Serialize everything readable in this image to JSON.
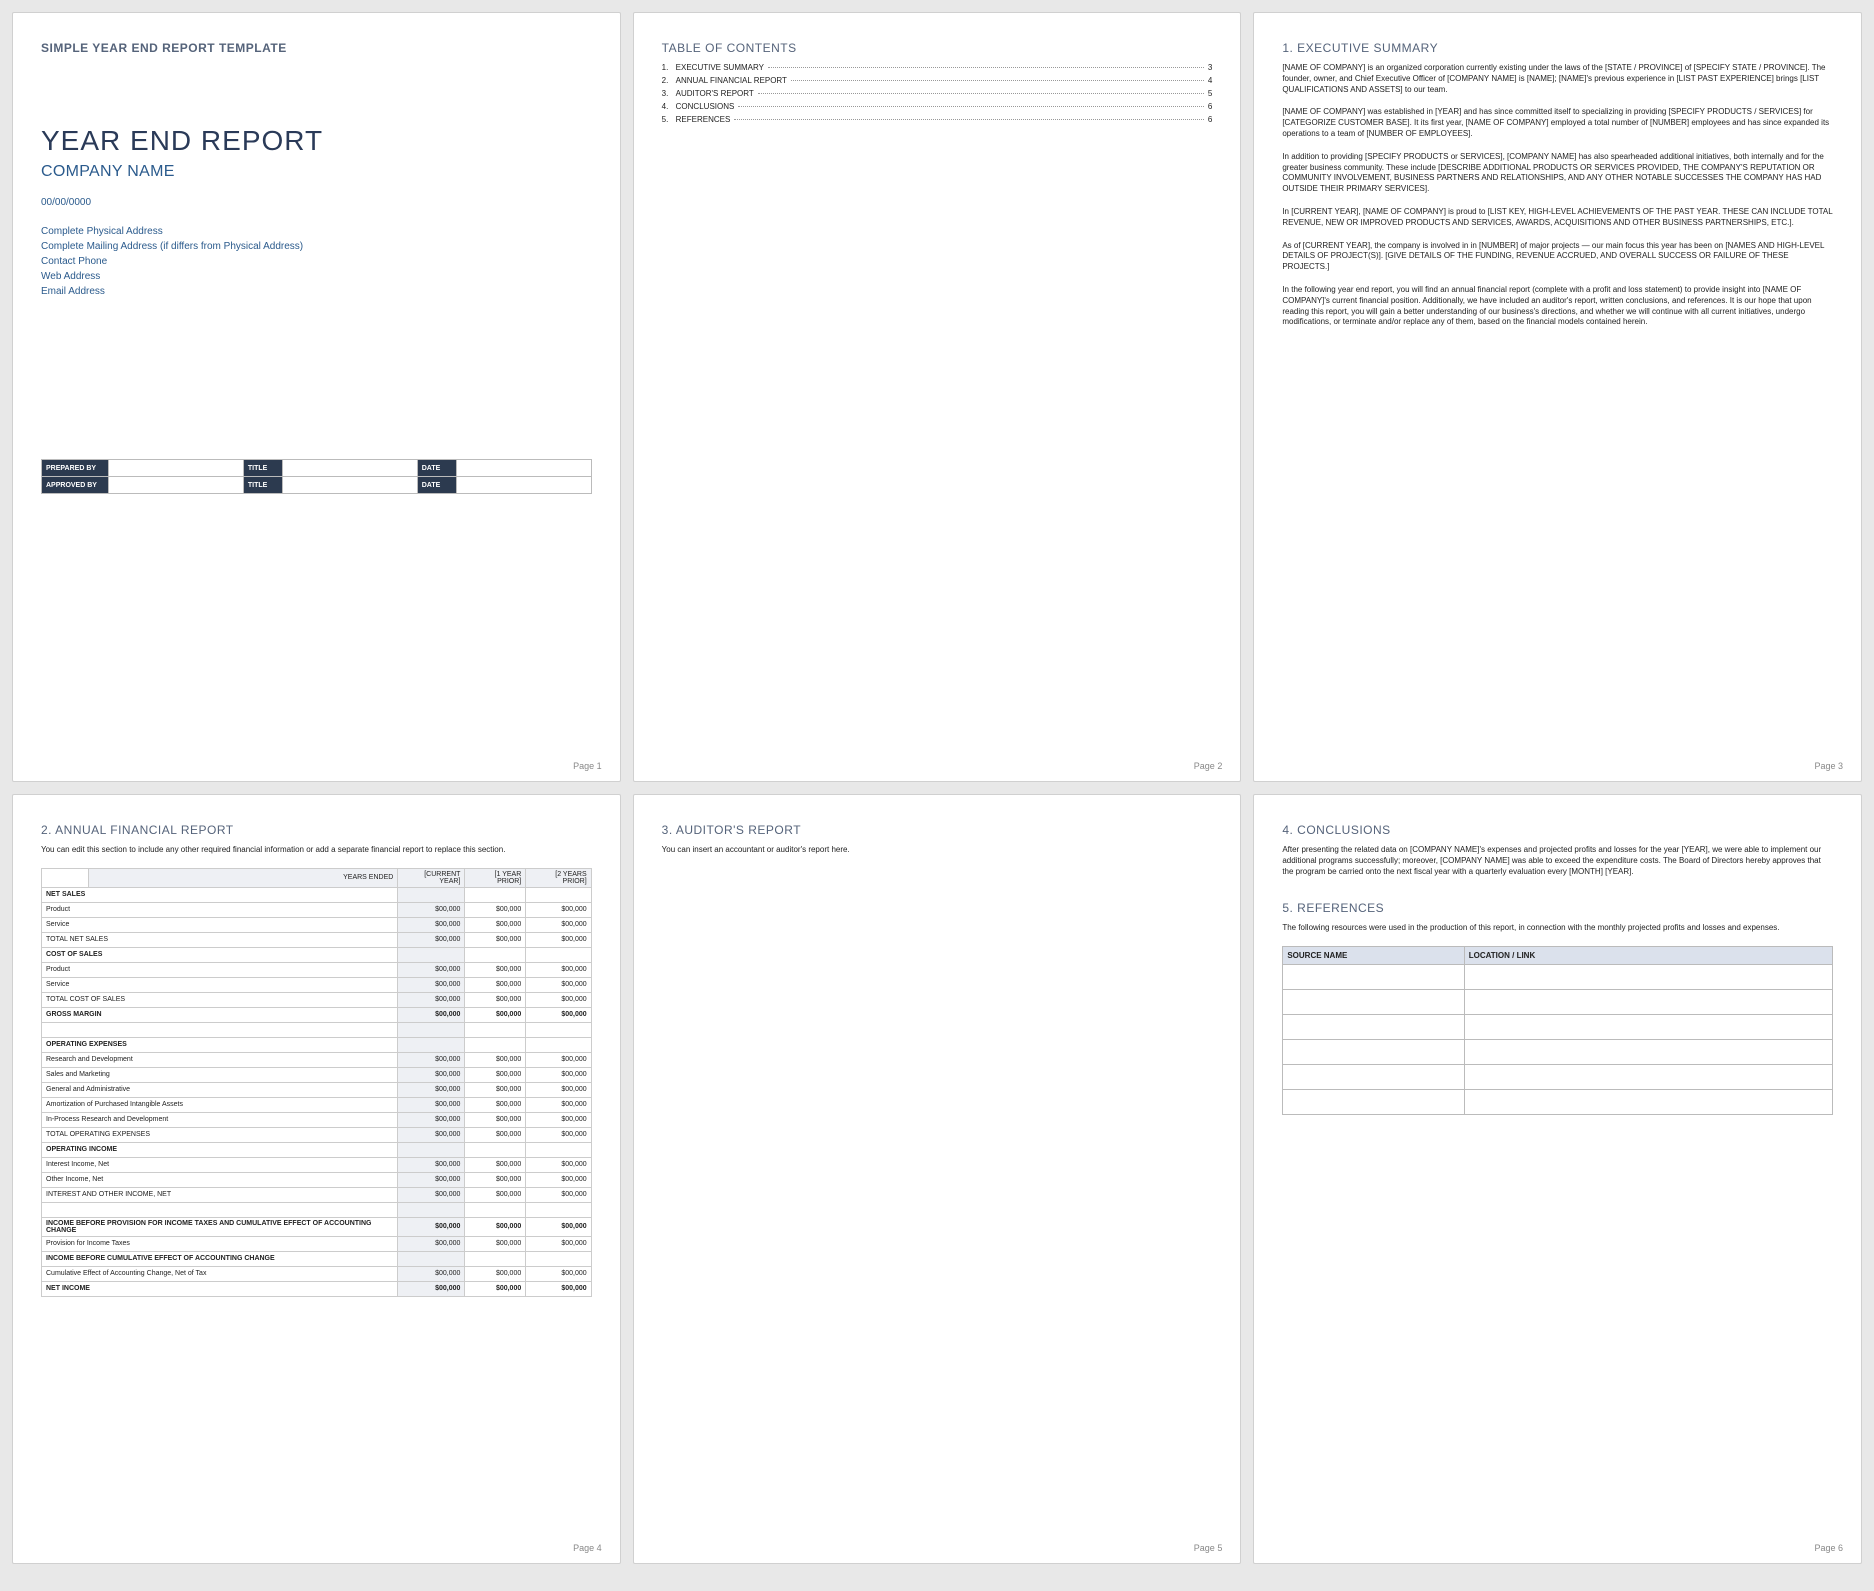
{
  "tmpl_header": "SIMPLE YEAR END REPORT TEMPLATE",
  "title": "YEAR END REPORT",
  "subtitle": "COMPANY NAME",
  "date": "00/00/0000",
  "meta": {
    "addr1": "Complete Physical Address",
    "addr2": "Complete Mailing Address (if differs from Physical Address)",
    "phone": "Contact Phone",
    "web": "Web Address",
    "email": "Email Address"
  },
  "sig": {
    "prep": "PREPARED BY",
    "appr": "APPROVED BY",
    "title": "TITLE",
    "date": "DATE"
  },
  "toc_h": "TABLE OF CONTENTS",
  "toc": [
    {
      "n": "1.",
      "t": "EXECUTIVE SUMMARY",
      "p": "3"
    },
    {
      "n": "2.",
      "t": "ANNUAL FINANCIAL REPORT",
      "p": "4"
    },
    {
      "n": "3.",
      "t": "AUDITOR'S REPORT",
      "p": "5"
    },
    {
      "n": "4.",
      "t": "CONCLUSIONS",
      "p": "6"
    },
    {
      "n": "5.",
      "t": "REFERENCES",
      "p": "6"
    }
  ],
  "p1": "Page 1",
  "p2": "Page 2",
  "p3": "Page 3",
  "p4": "Page 4",
  "p5": "Page 5",
  "p6": "Page 6",
  "s1_h": "1.  EXECUTIVE SUMMARY",
  "s1": {
    "a": "[NAME OF COMPANY] is an organized corporation currently existing under the laws of the [STATE / PROVINCE] of [SPECIFY STATE / PROVINCE].  The founder, owner, and Chief Executive Officer of [COMPANY NAME] is [NAME]; [NAME]'s previous experience in [LIST PAST EXPERIENCE] brings [LIST QUALIFICATIONS AND ASSETS] to our team.",
    "b": "[NAME OF COMPANY] was established in [YEAR] and has since committed itself to specializing in providing [SPECIFY PRODUCTS / SERVICES] for [CATEGORIZE CUSTOMER BASE]. It its first year, [NAME OF COMPANY] employed a total number of [NUMBER] employees and has since expanded its operations to a team of [NUMBER OF EMPLOYEES].",
    "c": "In addition to providing [SPECIFY PRODUCTS or SERVICES], [COMPANY NAME] has also spearheaded additional initiatives, both internally and for the greater business community. These include [DESCRIBE ADDITIONAL PRODUCTS OR SERVICES PROVIDED, THE COMPANY'S REPUTATION OR COMMUNITY INVOLVEMENT, BUSINESS PARTNERS AND RELATIONSHIPS, AND ANY OTHER NOTABLE SUCCESSES THE COMPANY HAS HAD OUTSIDE THEIR PRIMARY SERVICES].",
    "d": "In [CURRENT YEAR], [NAME OF COMPANY] is proud to [LIST KEY, HIGH-LEVEL ACHIEVEMENTS OF THE PAST YEAR. THESE CAN INCLUDE TOTAL REVENUE, NEW OR IMPROVED PRODUCTS AND SERVICES, AWARDS, ACQUISITIONS AND OTHER BUSINESS PARTNERSHIPS, ETC.].",
    "e": "As of [CURRENT YEAR], the company is involved in in [NUMBER] of major projects — our main focus this year has been on [NAMES AND HIGH-LEVEL DETAILS OF PROJECT(S)]. [GIVE DETAILS OF THE FUNDING, REVENUE ACCRUED, AND OVERALL SUCCESS OR FAILURE OF THESE PROJECTS.]",
    "f": "In the following year end report, you will find an annual financial report (complete with a profit and loss statement) to provide insight into [NAME OF COMPANY]'s current financial position. Additionally, we have included an auditor's report, written conclusions, and references. It is our hope that upon reading this report, you will gain a better understanding of our business's directions, and whether we will continue with all current initiatives, undergo modifications, or terminate and/or replace any of them, based on the financial models contained herein."
  },
  "s2_h": "2.  ANNUAL FINANCIAL REPORT",
  "s2_intro": "You can edit this section to include any other required financial information or add a separate financial report to replace this section.",
  "fin": {
    "yh": "YEARS ENDED",
    "c1": "[CURRENT YEAR]",
    "c2": "[1 YEAR PRIOR]",
    "c3": "[2 YEARS PRIOR]",
    "v": "$00,000",
    "vb": "$00,000",
    "r": {
      "ns": "NET SALES",
      "prod": "Product",
      "serv": "Service",
      "tns": "TOTAL NET SALES",
      "cos": "COST OF SALES",
      "tcos": "TOTAL COST OF SALES",
      "gm": "GROSS MARGIN",
      "oe": "OPERATING EXPENSES",
      "rd": "Research and Development",
      "sm": "Sales and Marketing",
      "ga": "General and Administrative",
      "amort": "Amortization of Purchased Intangible Assets",
      "iprd": "In-Process Research and Development",
      "toe": "TOTAL OPERATING EXPENSES",
      "oi": "OPERATING INCOME",
      "iin": "Interest Income, Net",
      "oin": "Other Income, Net",
      "ioin": "INTEREST AND OTHER INCOME, NET",
      "ibp": "INCOME BEFORE PROVISION FOR INCOME TAXES AND CUMULATIVE EFFECT OF ACCOUNTING CHANGE",
      "pit": "Provision for Income Taxes",
      "ibc": "INCOME BEFORE CUMULATIVE EFFECT OF ACCOUNTING CHANGE",
      "ceac": "Cumulative Effect of Accounting Change, Net of Tax",
      "ni": "NET INCOME"
    }
  },
  "s3_h": "3.  AUDITOR'S REPORT",
  "s3_txt": "You can insert an accountant or auditor's report here.",
  "s4_h": "4.  CONCLUSIONS",
  "s4_txt": "After presenting the related data on [COMPANY NAME]'s expenses and projected profits and losses for the year [YEAR], we were able to implement our additional programs successfully; moreover, [COMPANY NAME] was able to exceed the expenditure costs. The Board of Directors hereby approves that the program be carried onto the next fiscal year with a quarterly evaluation every [MONTH] [YEAR].",
  "s5_h": "5.  REFERENCES",
  "s5_txt": "The following resources were used in the production of this report, in connection with the monthly projected profits and losses and expenses.",
  "ref": {
    "c1": "SOURCE NAME",
    "c2": "LOCATION / LINK"
  }
}
